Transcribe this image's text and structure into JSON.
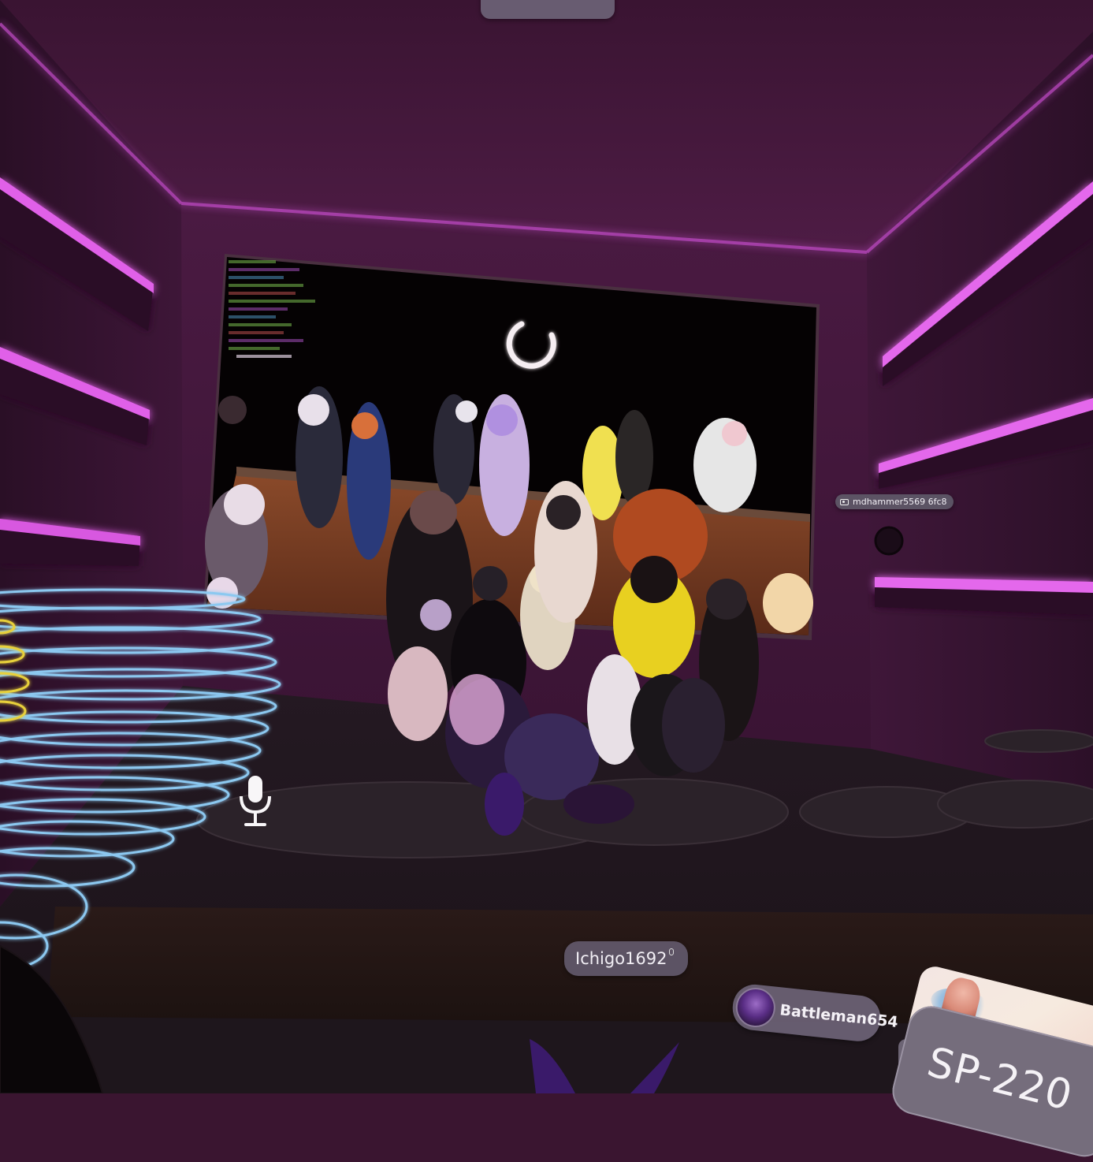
{
  "nameplates": {
    "camera_user": "mdhammer5569 6fc8",
    "ichigo": "Ichigo1692",
    "battleman": "Battleman654"
  },
  "panel": {
    "label": "SP-220"
  },
  "icons": {
    "camera": "camera-icon",
    "mic": "microphone-icon",
    "loading": "loading-spinner-icon",
    "mic_small": "mic-small-icon"
  },
  "colors": {
    "neon": "#d14bd8",
    "wall": "#3a1532",
    "room_back": "#4a1a40",
    "screen": "#050203",
    "ring_blue": "#8cc8f0",
    "ring_yellow": "#e8d03a",
    "nameplate": "#5c5466"
  }
}
